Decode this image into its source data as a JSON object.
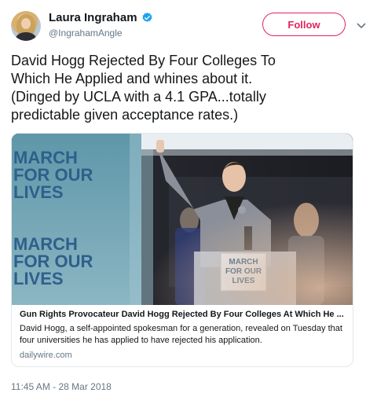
{
  "user": {
    "display_name": "Laura Ingraham",
    "handle": "@IngrahamAngle",
    "verified": true
  },
  "follow_label": "Follow",
  "tweet_text": "David Hogg Rejected By Four Colleges To\nWhich He Applied and whines about it.\n(Dinged by UCLA with a 4.1 GPA...totally\npredictable given acceptance rates.)",
  "card": {
    "image_signs": [
      "MARCH FOR OUR LIVES",
      "MARCH FOR OUR LIVES",
      "MARCH FOR OUR LIVES"
    ],
    "title": "Gun Rights Provocateur David Hogg Rejected By Four Colleges At Which He ...",
    "description": "David Hogg, a self-appointed spokesman for a generation, revealed on Tuesday that four universities he has applied to have rejected his application.",
    "domain": "dailywire.com"
  },
  "timestamp": "11:45 AM - 28 Mar 2018",
  "colors": {
    "follow_accent": "#e0245e",
    "verified_blue": "#1da1f2",
    "sign_blue": "#2f5f8a"
  }
}
